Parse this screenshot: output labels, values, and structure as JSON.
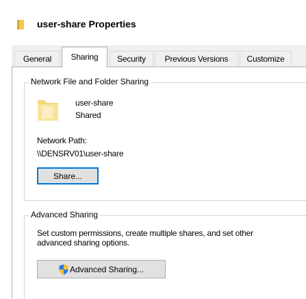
{
  "window": {
    "title": "user-share Properties"
  },
  "tabs": [
    {
      "label": "General",
      "active": false
    },
    {
      "label": "Sharing",
      "active": true
    },
    {
      "label": "Security",
      "active": false
    },
    {
      "label": "Previous Versions",
      "active": false
    },
    {
      "label": "Customize",
      "active": false
    }
  ],
  "network_sharing": {
    "legend": "Network File and Folder Sharing",
    "folder_name": "user-share",
    "folder_status": "Shared",
    "path_label": "Network Path:",
    "path_value": "\\\\DENSRV01\\user-share",
    "share_button": "Share..."
  },
  "advanced_sharing": {
    "legend": "Advanced Sharing",
    "description_line1": "Set custom permissions, create multiple shares, and set other",
    "description_line2": "advanced sharing options.",
    "button": "Advanced Sharing..."
  },
  "colors": {
    "dialog_bg": "#f0f0f0",
    "panel_bg": "#ffffff",
    "folder_yellow": "#f5d67a",
    "focus_blue": "#0078d7"
  }
}
